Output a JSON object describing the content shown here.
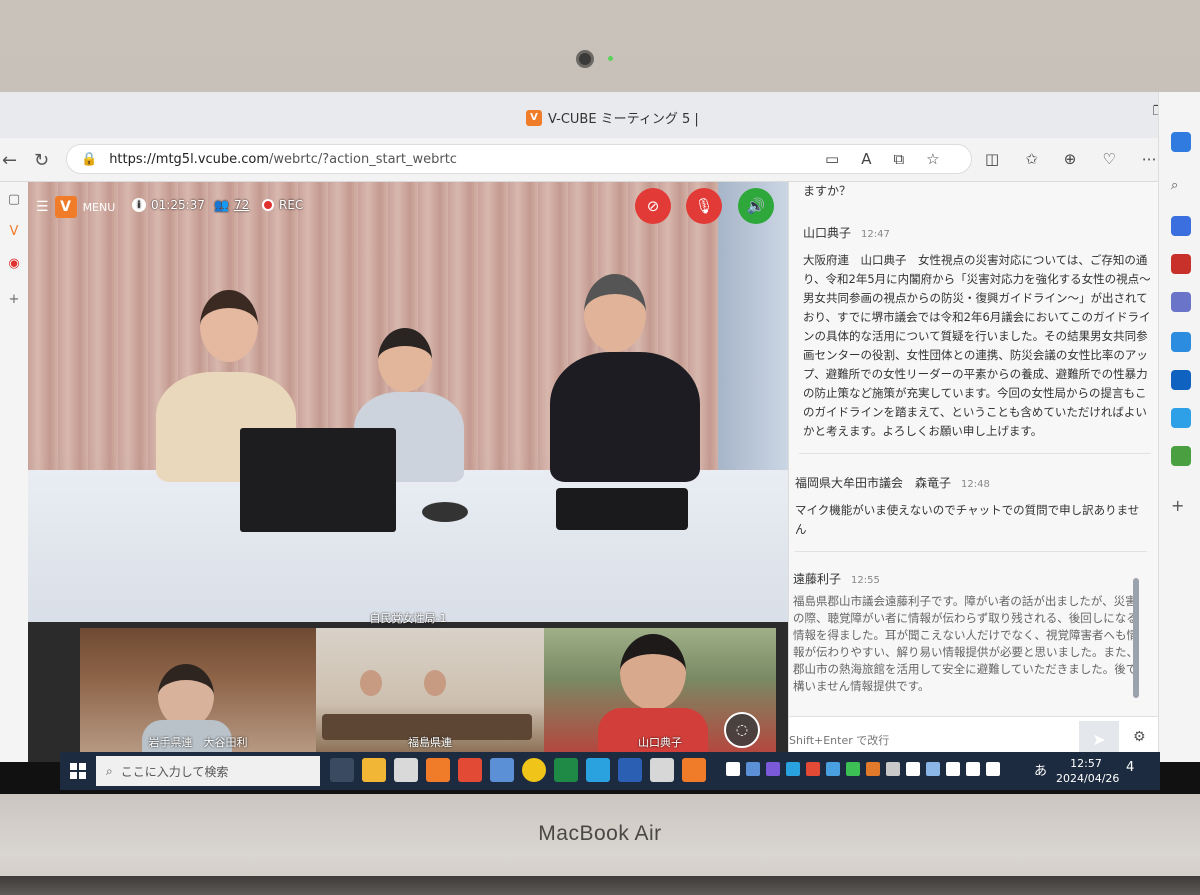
{
  "browser": {
    "tab_title": "V-CUBE ミーティング 5 |",
    "tab_logo": "V",
    "url_protocol": "https://mtg5l.vcube.com",
    "url_path": "/webrtc/?action_start_webrtc"
  },
  "meeting": {
    "menu_label": "MENU",
    "menu_logo": "V",
    "elapsed_time": "01:25:37",
    "participant_count": "72",
    "rec_label": "REC",
    "main_video_label": "自民党女性局-1",
    "thumbnails": [
      {
        "label": "岩手県連　大谷田利"
      },
      {
        "label": "福島県連"
      },
      {
        "label": "山口典子"
      }
    ],
    "colors": {
      "brand": "#f07c2a",
      "stop_red": "#e23a36",
      "speaker_green": "#2ea83a"
    }
  },
  "chat": {
    "top_text": "ますか？",
    "messages": [
      {
        "sender": "山口典子",
        "time": "12:47",
        "body": "大阪府連　山口典子　女性視点の災害対応については、ご存知の通り、令和2年5月に内閣府から「災害対応力を強化する女性の視点～男女共同参画の視点からの防災・復興ガイドライン～」が出されており、すでに堺市議会では令和2年6月議会においてこのガイドラインの具体的な活用について質疑を行いました。その結果男女共同参画センターの役割、女性団体との連携、防災会議の女性比率のアップ、避難所での女性リーダーの平素からの養成、避難所での性暴力の防止策など施策が充実しています。今回の女性局からの提言もこのガイドラインを踏まえて、ということも含めていただければよいかと考えます。よろしくお願い申し上げます。"
      },
      {
        "sender": "福岡県大牟田市議会　森竜子",
        "time": "12:48",
        "body": "マイク機能がいま使えないのでチャットでの質問で申し訳ありません"
      },
      {
        "sender": "遠藤利子",
        "time": "12:55",
        "body": "福島県郡山市議会遠藤利子です。障がい者の話が出ましたが、災害の際、聴覚障がい者に情報が伝わらず取り残される、後回しになる情報を得ました。耳が聞こえない人だけでなく、視覚障害者へも情報が伝わりやすい、解り易い情報提供が必要と思いました。また、郡山市の熱海旅館を活用して安全に避難していただきました。後で構いません情報提供です。"
      }
    ],
    "input_placeholder": "Shift+Enter で改行"
  },
  "taskbar": {
    "search_placeholder": "ここに入力して検索",
    "ime_label": "あ",
    "time": "12:57",
    "date": "2024/04/26",
    "notification_count": "4"
  },
  "device": {
    "brand": "MacBook Air"
  }
}
